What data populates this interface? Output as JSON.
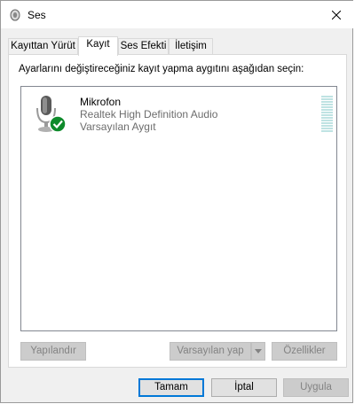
{
  "window": {
    "title": "Ses"
  },
  "tabs": [
    {
      "label": "Kayıttan Yürüt",
      "active": false
    },
    {
      "label": "Kayıt",
      "active": true
    },
    {
      "label": "Ses Efekti",
      "active": false
    },
    {
      "label": "İletişim",
      "active": false
    }
  ],
  "panel": {
    "instruction": "Ayarlarını değiştireceğiniz kayıt yapma aygıtını aşağıdan seçin:",
    "device": {
      "name": "Mikrofon",
      "driver": "Realtek High Definition Audio",
      "status": "Varsayılan Aygıt",
      "icon": "microphone-icon",
      "badge_icon": "check-icon",
      "level": 0
    },
    "buttons": {
      "configure": "Yapılandır",
      "set_default": "Varsayılan yap",
      "properties": "Özellikler"
    }
  },
  "footer": {
    "ok": "Tamam",
    "cancel": "İptal",
    "apply": "Uygula"
  },
  "colors": {
    "accent": "#0078d7",
    "check_badge": "#0e8a2b",
    "meter": "#bfe3e3"
  }
}
